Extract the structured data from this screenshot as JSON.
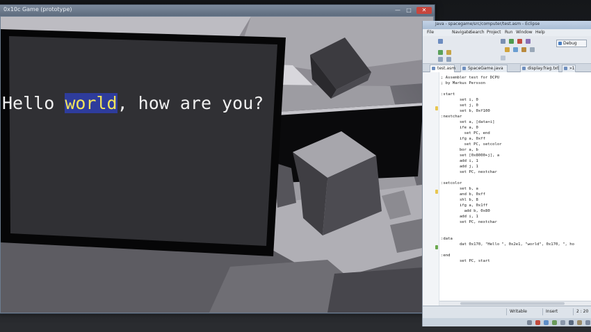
{
  "game_window": {
    "title": "0x10c Game (prototype)",
    "controls": {
      "minimize": "—",
      "maximize": "□",
      "close": "✕"
    }
  },
  "monitor": {
    "text_before": "Hello ",
    "text_highlight": "world",
    "text_after": ", how are you?",
    "highlight_bg": "#2e3c9c",
    "highlight_fg": "#f2e45a"
  },
  "ide": {
    "title": "Java - spacegame/src/computer/test.asm - Eclipse",
    "menu": [
      "File",
      "Navigate",
      "Search",
      "Project",
      "Run",
      "Window",
      "Help"
    ],
    "debug_label": "Debug",
    "tabs": [
      "test.asm",
      "SpaceGame.java",
      "display.frag.txt",
      "»1"
    ],
    "code": [
      "; Assembler test for DCPU",
      "; by Markus Persson",
      "",
      ":start",
      "        set i, 0",
      "        set j, 0",
      "        set b, 0xf100",
      ":nextchar",
      "        set a, [data+i]",
      "        ife a, 0",
      "          set PC, end",
      "        ifg a, 0xff",
      "          set PC, setcolor",
      "        bor a, b",
      "        set [0x8000+j], a",
      "        add i, 1",
      "        add j, 1",
      "        set PC, nextchar",
      "",
      ":setcolor",
      "        set b, a",
      "        and b, 0xff",
      "        shl b, 8",
      "        ifg a, 0x1ff",
      "          add b, 0x80",
      "        add i, 1",
      "        set PC, nextchar",
      "",
      "",
      ":data",
      "        dat 0x170, \"Hello \", 0x2e1, \"world\", 0x170, \", ho",
      "",
      ":end",
      "        set PC, start"
    ],
    "status": {
      "mode": "Writable",
      "insert": "Insert",
      "position": "2 : 20"
    }
  }
}
